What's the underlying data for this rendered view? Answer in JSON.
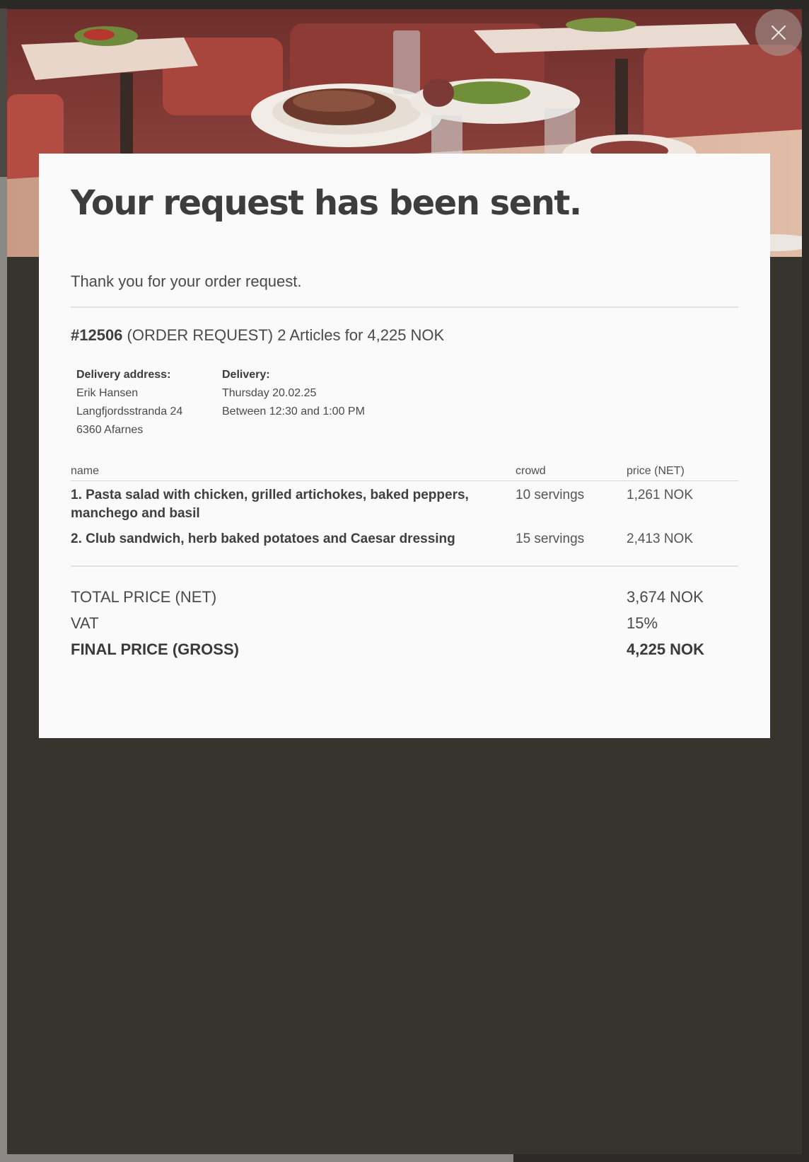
{
  "modal": {
    "close_icon": "close-icon",
    "title": "Your request has been sent.",
    "thanks": "Thank you for your order request.",
    "order": {
      "number": "#12506",
      "summary": "(ORDER REQUEST) 2 Articles for 4,225 NOK"
    },
    "delivery_address": {
      "label": "Delivery address:",
      "name": "Erik Hansen",
      "street": "Langfjordsstranda 24",
      "city": "6360 Afarnes"
    },
    "delivery": {
      "label": "Delivery:",
      "date": "Thursday 20.02.25",
      "time": "Between 12:30 and 1:00 PM"
    },
    "table": {
      "headers": [
        "name",
        "crowd",
        "price (NET)"
      ],
      "rows": [
        {
          "name": "1. Pasta salad with chicken, grilled artichokes, baked peppers, manchego and basil",
          "crowd": "10 servings",
          "price": "1,261 NOK"
        },
        {
          "name": "2. Club sandwich, herb baked potatoes and Caesar dressing",
          "crowd": "15 servings",
          "price": "2,413 NOK"
        }
      ]
    },
    "totals": {
      "net_label": "TOTAL PRICE (NET)",
      "net_value": "3,674 NOK",
      "vat_label": "VAT",
      "vat_value": "15%",
      "gross_label": "FINAL PRICE (GROSS)",
      "gross_value": "4,225 NOK"
    }
  },
  "colors": {
    "overlay": "#37332d",
    "card": "#fafafa",
    "text": "#3f3f3f"
  }
}
